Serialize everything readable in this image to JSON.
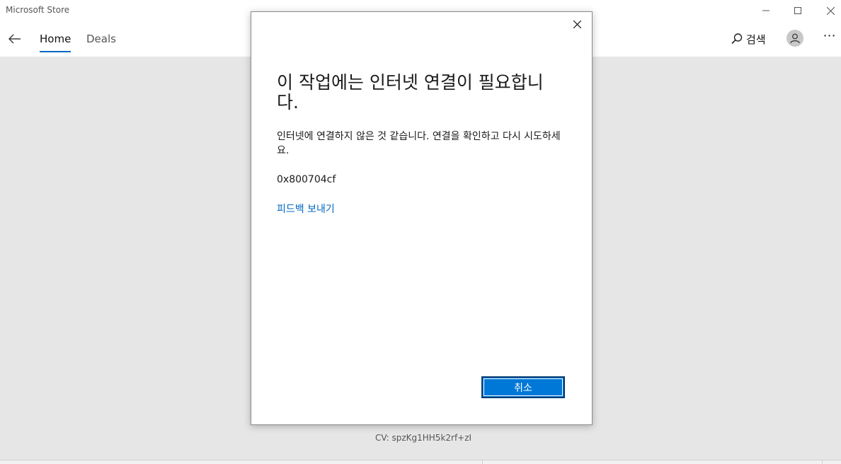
{
  "window": {
    "title": "Microsoft Store"
  },
  "nav": {
    "tabs": [
      {
        "label": "Home",
        "active": true
      },
      {
        "label": "Deals",
        "active": false
      }
    ],
    "search_label": "검색"
  },
  "background": {
    "cv_text": "CV: spzKg1HH5k2rf+zI"
  },
  "dialog": {
    "title": "이 작업에는 인터넷 연결이 필요합니다.",
    "message": "인터넷에 연결하지 않은 것 같습니다. 연결을 확인하고 다시 시도하세요.",
    "error_code": "0x800704cf",
    "feedback_link": "피드백 보내기",
    "cancel_label": "취소"
  },
  "colors": {
    "accent": "#0067c0",
    "button": "#0078d7"
  },
  "icons": [
    "back-arrow-icon",
    "search-icon",
    "user-icon",
    "more-icon",
    "minimize-icon",
    "maximize-icon",
    "close-icon"
  ]
}
